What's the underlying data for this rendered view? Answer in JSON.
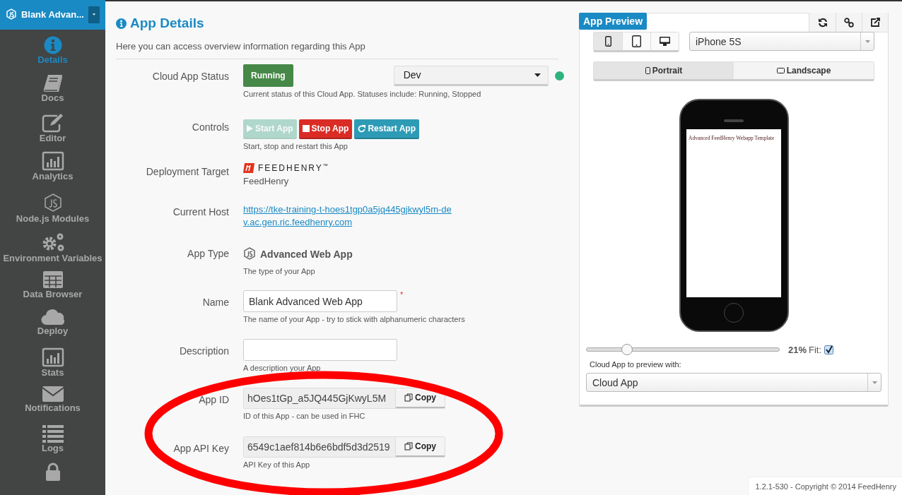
{
  "sidebar": {
    "app_title": "Blank Advan...",
    "items": [
      {
        "label": "Details",
        "selected": true
      },
      {
        "label": "Docs",
        "selected": false
      },
      {
        "label": "Editor",
        "selected": false
      },
      {
        "label": "Analytics",
        "selected": false
      },
      {
        "label": "Node.js Modules",
        "selected": false
      },
      {
        "label": "Environment Variables",
        "selected": false
      },
      {
        "label": "Data Browser",
        "selected": false
      },
      {
        "label": "Deploy",
        "selected": false
      },
      {
        "label": "Stats",
        "selected": false
      },
      {
        "label": "Notifications",
        "selected": false
      },
      {
        "label": "Logs",
        "selected": false
      },
      {
        "selected": false
      }
    ]
  },
  "details": {
    "title": "App Details",
    "intro": "Here you can access overview information regarding this App",
    "fields": [
      {
        "kind": "status",
        "label": "Cloud App Status",
        "status": "Running",
        "environment": "Dev",
        "online": true,
        "help": "Current status of this Cloud App. Statuses include: Running, Stopped"
      },
      {
        "kind": "controls",
        "label": "Controls",
        "buttons": [
          {
            "kind": "start",
            "label": "Start App",
            "disabled": true
          },
          {
            "kind": "stop",
            "label": "Stop App",
            "disabled": false
          },
          {
            "kind": "restart",
            "label": "Restart App",
            "disabled": false
          }
        ],
        "help": "Start, stop and restart this App"
      },
      {
        "kind": "target",
        "label": "Deployment Target",
        "logo_text": "FEEDHENRY$^{™}$",
        "value": "FeedHenry"
      },
      {
        "kind": "link",
        "label": "Current Host",
        "value": "https://tke-training-t-hoes1tgp0a5jq445gjkwyl5m-dev.ac.gen.ric.feedhenry.com"
      },
      {
        "kind": "type",
        "label": "App Type",
        "value": "Advanced Web App",
        "help": "The type of your App"
      },
      {
        "kind": "input",
        "label": "Name",
        "value": "Blank Advanced Web App",
        "required_mark": "*",
        "help": "The name of your App - try to stick with alphanumeric characters"
      },
      {
        "kind": "input",
        "label": "Description",
        "help": "A description your App"
      },
      {
        "kind": "copy",
        "label": "App ID",
        "value": "hOes1tGp_a5JQ445GjKwyL5M",
        "button": "Copy",
        "help": "ID of this App - can be used in FHC"
      },
      {
        "kind": "copy",
        "label": "App API Key",
        "value": "6549c1aef814b6e6bdf5d3d2519",
        "button": "Copy",
        "help": "API Key of this App"
      }
    ]
  },
  "preview": {
    "title": "App Preview",
    "devices": [
      {
        "selected": true
      },
      {
        "selected": false
      },
      {
        "selected": false
      }
    ],
    "device": "iPhone 5S",
    "orientations": [
      {
        "label": "Portrait",
        "selected": true
      },
      {
        "label": "Landscape",
        "selected": false
      }
    ],
    "screen_text": "Advanced FeedHenry Webapp Template",
    "zoom": {
      "level": 0.21,
      "reading": "21%",
      "fit_label": "Fit:",
      "fit_checked": true
    },
    "cloud_label": "Cloud App to preview with:",
    "cloud_app": "Cloud App"
  },
  "footer": "1.2.1-530 - Copyright © 2014 FeedHenry"
}
